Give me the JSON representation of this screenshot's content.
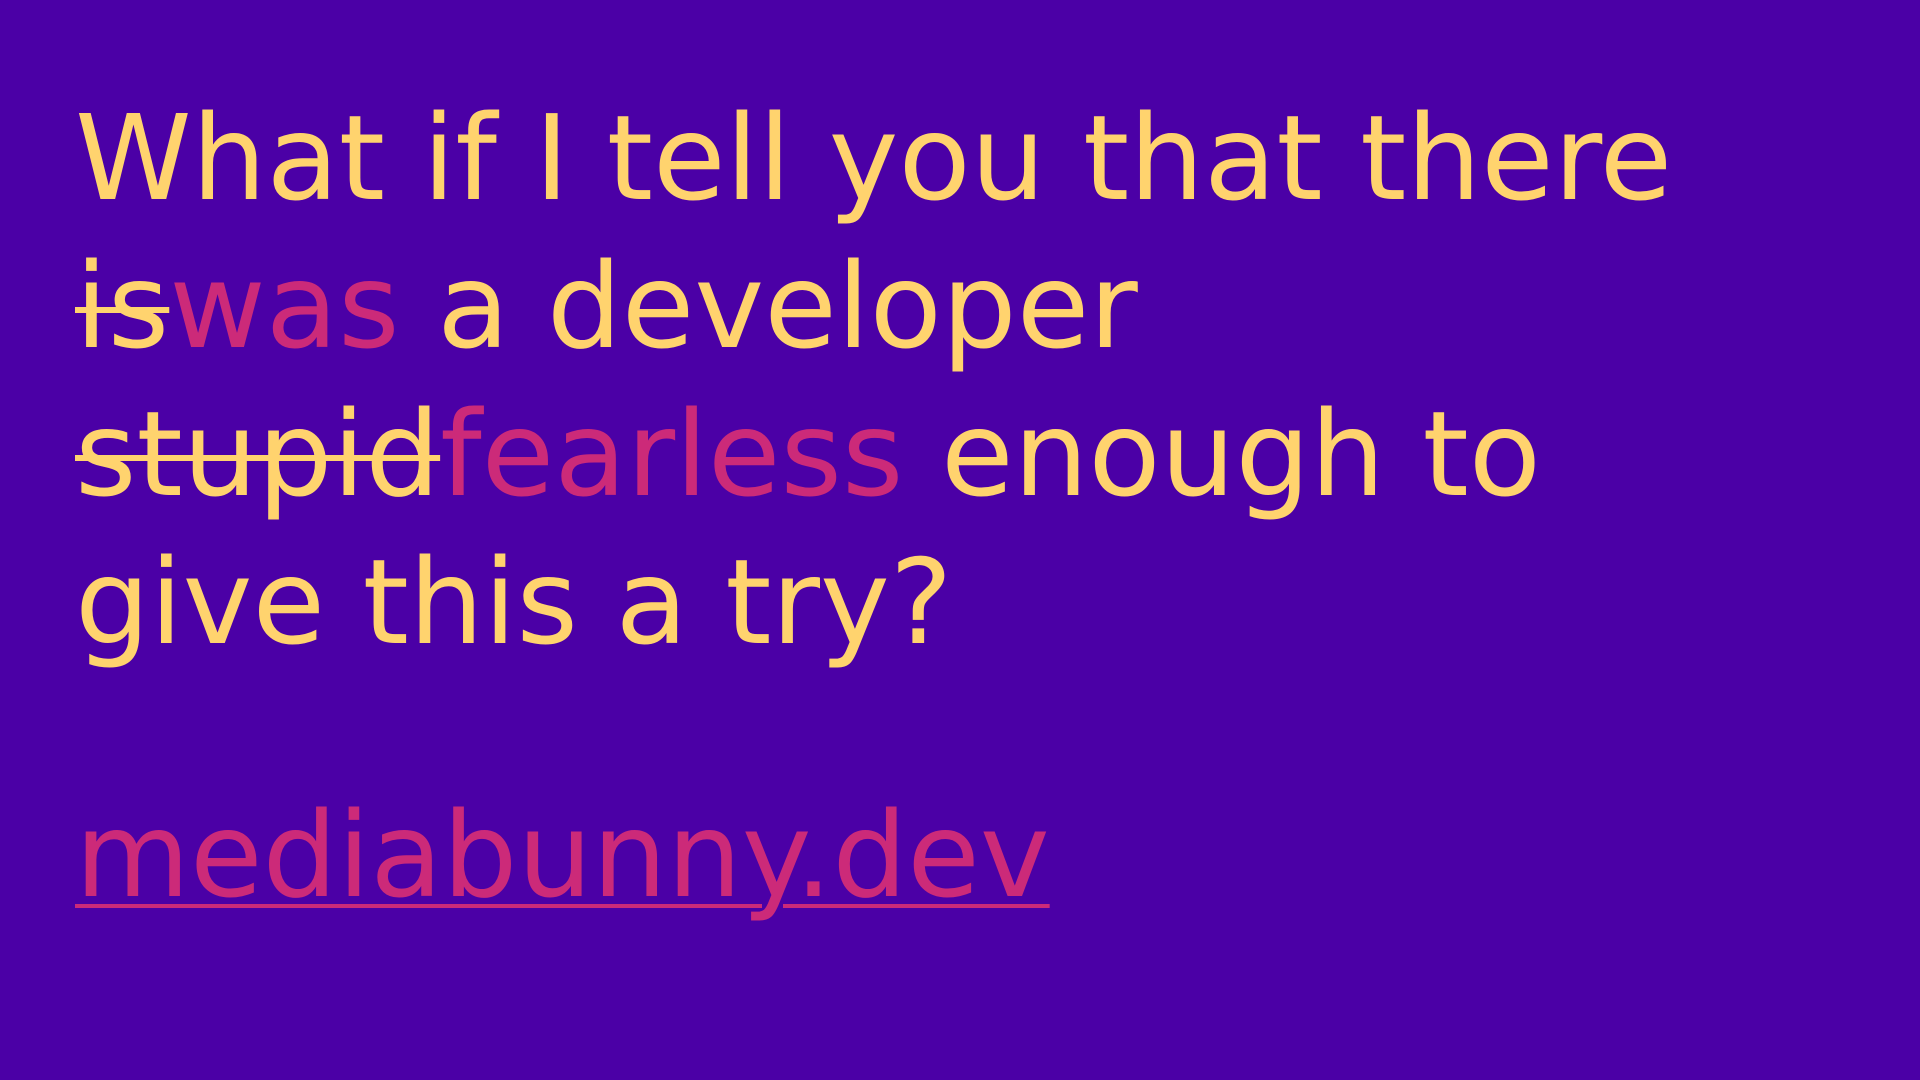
{
  "slide": {
    "line1": "What if I tell you that there",
    "line2_struck": "is",
    "line2_replacement": "was",
    "line2_rest": " a developer",
    "line3_struck": "stupid",
    "line3_replacement": "fearless",
    "line3_rest": " enough to",
    "line4": "give this a try?",
    "link": "mediabunny.dev"
  },
  "colors": {
    "background": "#4b00a6",
    "text": "#ffd36e",
    "accent": "#cc2a79"
  }
}
